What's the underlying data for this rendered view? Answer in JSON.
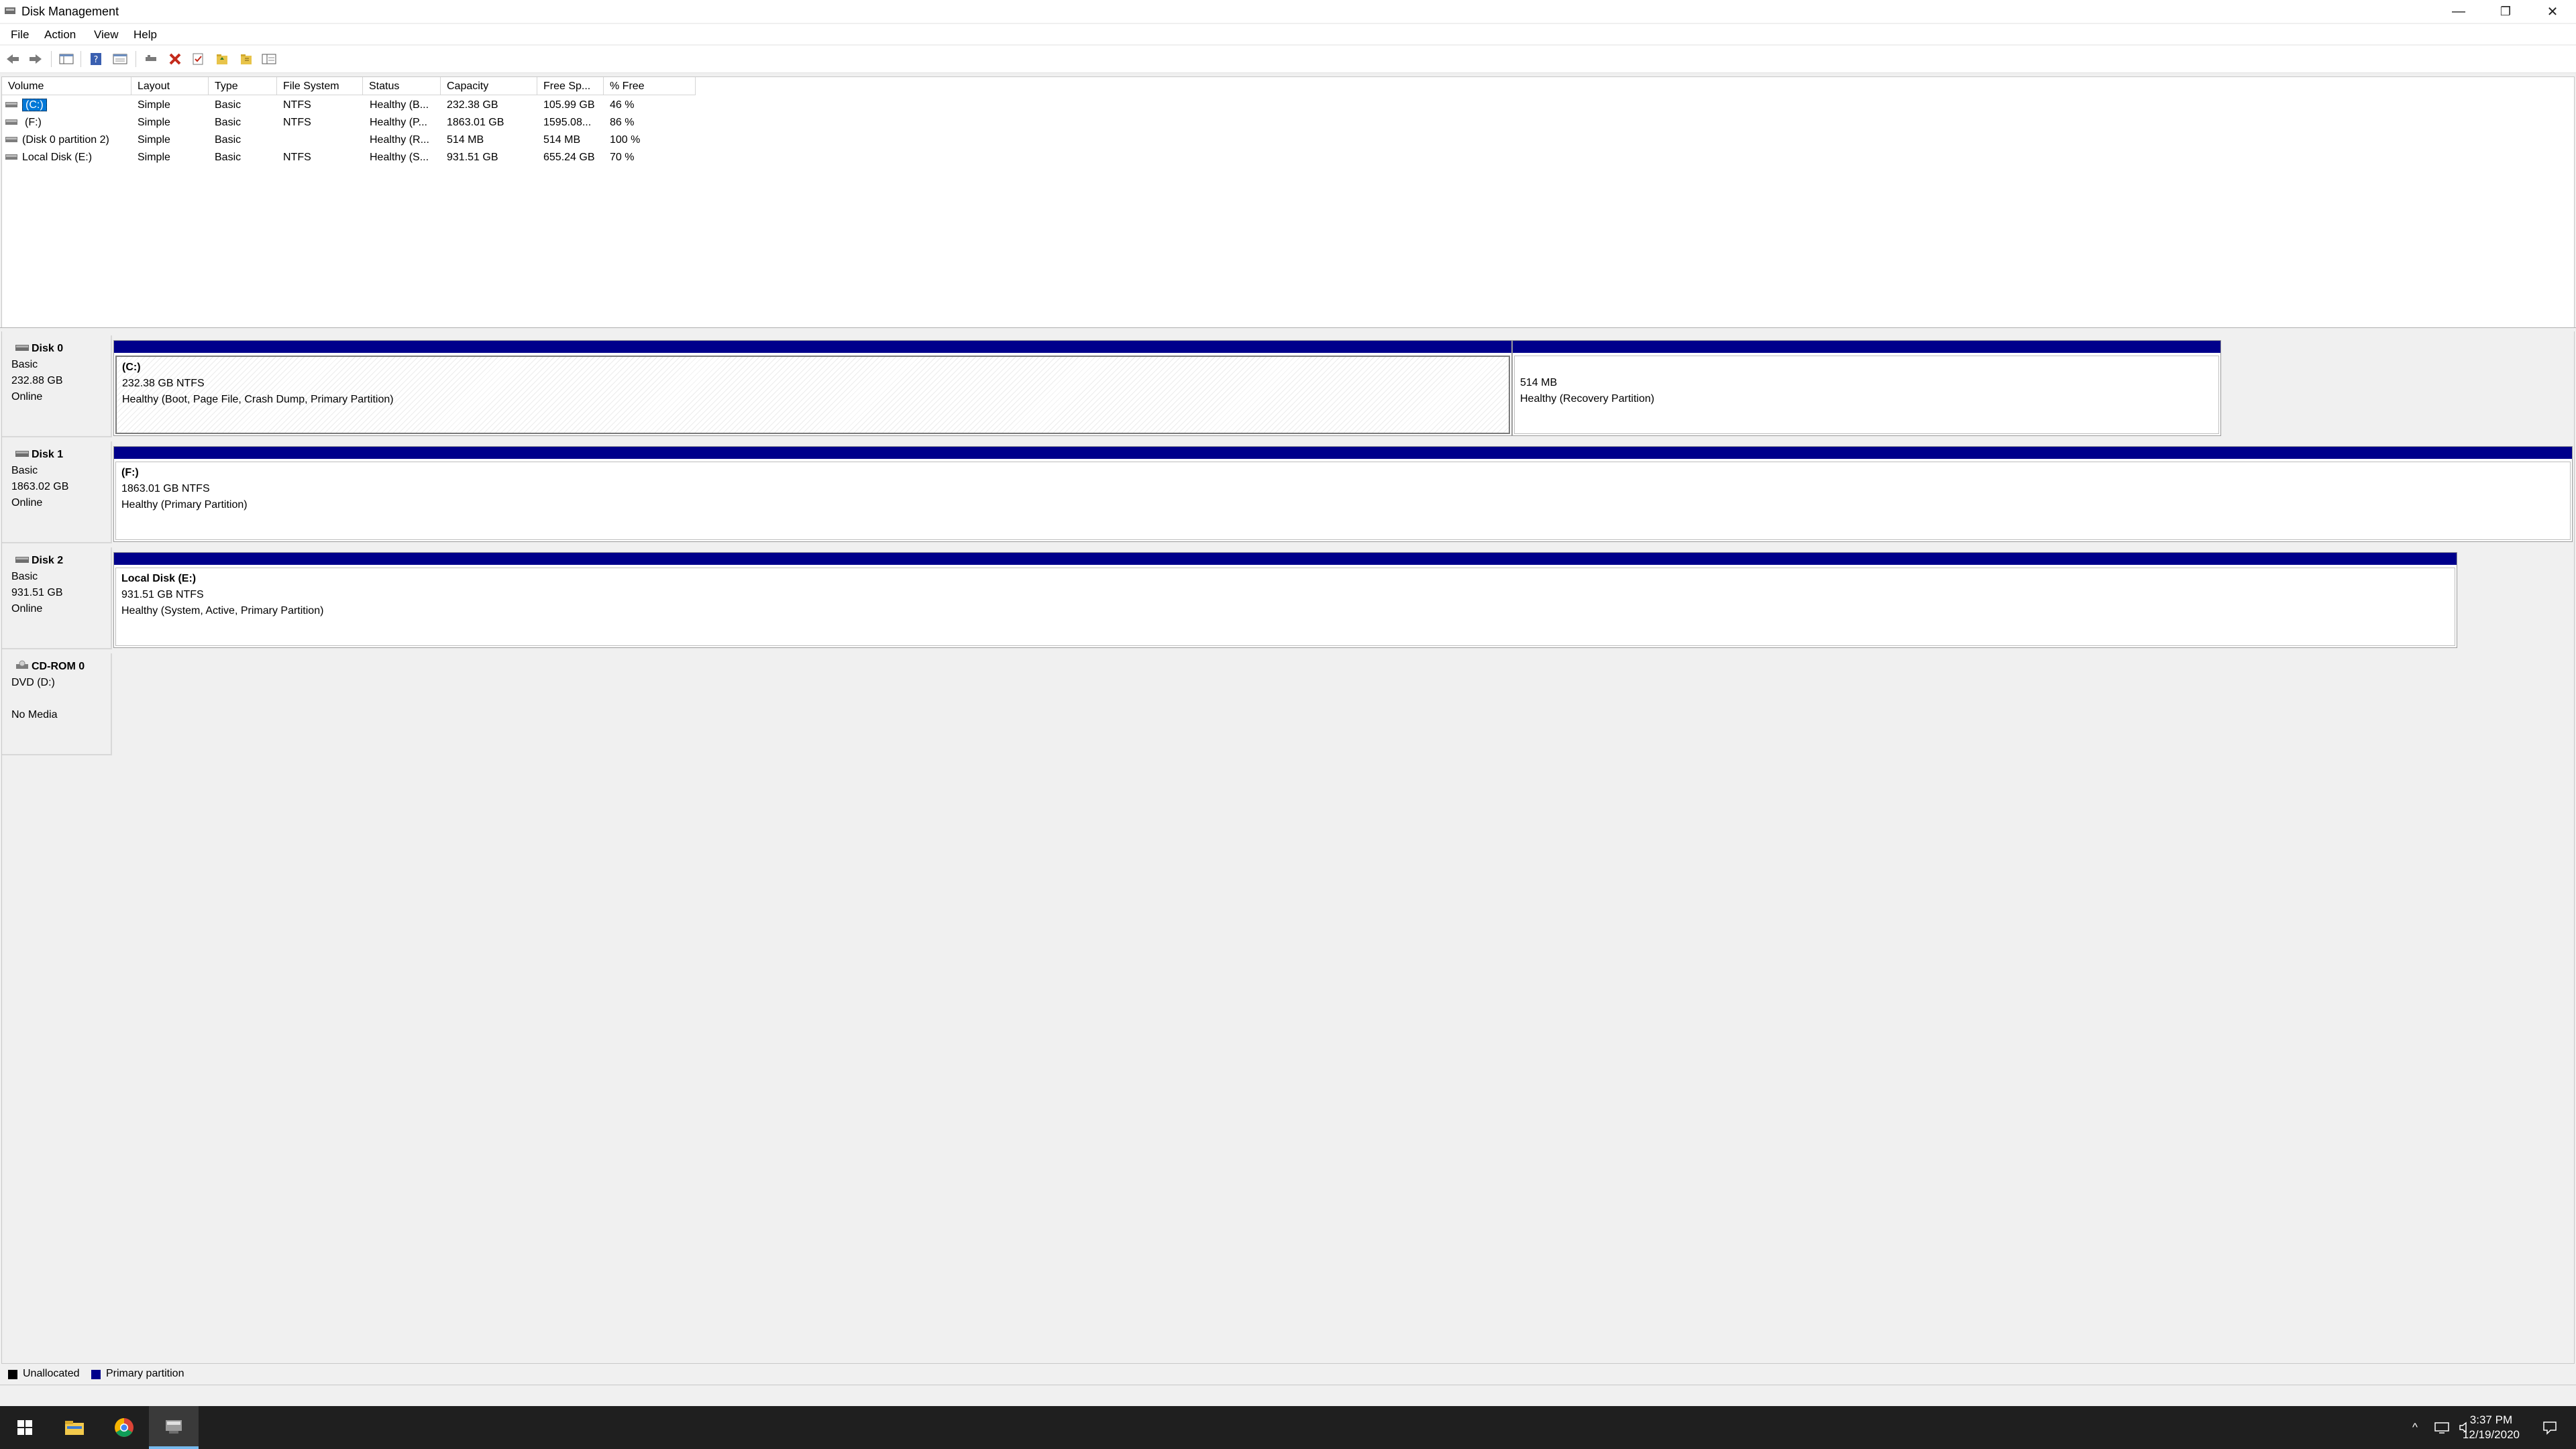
{
  "window": {
    "title": "Disk Management",
    "minimize": "—",
    "restore": "❐",
    "close": "✕"
  },
  "menu": [
    "File",
    "Action",
    "View",
    "Help"
  ],
  "toolbar": {
    "icons": [
      "back-icon",
      "forward-icon",
      "console-tree-icon",
      "help-icon",
      "properties-icon",
      "connect-icon",
      "delete-icon",
      "check-icon",
      "folder-up-icon",
      "folder-icon",
      "show-hide-icon"
    ]
  },
  "volume_list": {
    "columns": [
      "Volume",
      "Layout",
      "Type",
      "File System",
      "Status",
      "Capacity",
      "Free Sp...",
      "% Free"
    ],
    "rows": [
      {
        "volume": "(C:)",
        "layout": "Simple",
        "type": "Basic",
        "fs": "NTFS",
        "status": "Healthy (B...",
        "capacity": "232.38 GB",
        "free": "105.99 GB",
        "pct": "46 %"
      },
      {
        "volume": "(F:)",
        "layout": "Simple",
        "type": "Basic",
        "fs": "NTFS",
        "status": "Healthy (P...",
        "capacity": "1863.01 GB",
        "free": "1595.08...",
        "pct": "86 %"
      },
      {
        "volume": "(Disk 0 partition 2)",
        "layout": "Simple",
        "type": "Basic",
        "fs": "",
        "status": "Healthy (R...",
        "capacity": "514 MB",
        "free": "514 MB",
        "pct": "100 %"
      },
      {
        "volume": "Local Disk (E:)",
        "layout": "Simple",
        "type": "Basic",
        "fs": "NTFS",
        "status": "Healthy (S...",
        "capacity": "931.51 GB",
        "free": "655.24 GB",
        "pct": "70 %"
      }
    ]
  },
  "disks": [
    {
      "name": "Disk 0",
      "type": "Basic",
      "size": "232.88 GB",
      "state": "Online",
      "partitions": [
        {
          "title": "(C:)",
          "size": "232.38 GB NTFS",
          "status": "Healthy (Boot, Page File, Crash Dump, Primary Partition)"
        },
        {
          "title": "",
          "size": "514 MB",
          "status": "Healthy (Recovery Partition)"
        }
      ]
    },
    {
      "name": "Disk 1",
      "type": "Basic",
      "size": "1863.02 GB",
      "state": "Online",
      "partitions": [
        {
          "title": "(F:)",
          "size": "1863.01 GB NTFS",
          "status": "Healthy (Primary Partition)"
        }
      ]
    },
    {
      "name": "Disk 2",
      "type": "Basic",
      "size": "931.51 GB",
      "state": "Online",
      "partitions": [
        {
          "title": "Local Disk  (E:)",
          "size": "931.51 GB NTFS",
          "status": "Healthy (System, Active, Primary Partition)"
        }
      ]
    },
    {
      "name": "CD-ROM 0",
      "type": "DVD (D:)",
      "size": "",
      "state": "No Media",
      "partitions": []
    }
  ],
  "legend": [
    {
      "label": "Unallocated",
      "color": "#000000"
    },
    {
      "label": "Primary partition",
      "color": "#00008b"
    }
  ],
  "taskbar": {
    "apps": [
      "start-icon",
      "file-explorer-icon",
      "chrome-icon",
      "disk-management-icon"
    ],
    "tray_chevron": "^",
    "time": "3:37 PM",
    "date": "12/19/2020"
  }
}
